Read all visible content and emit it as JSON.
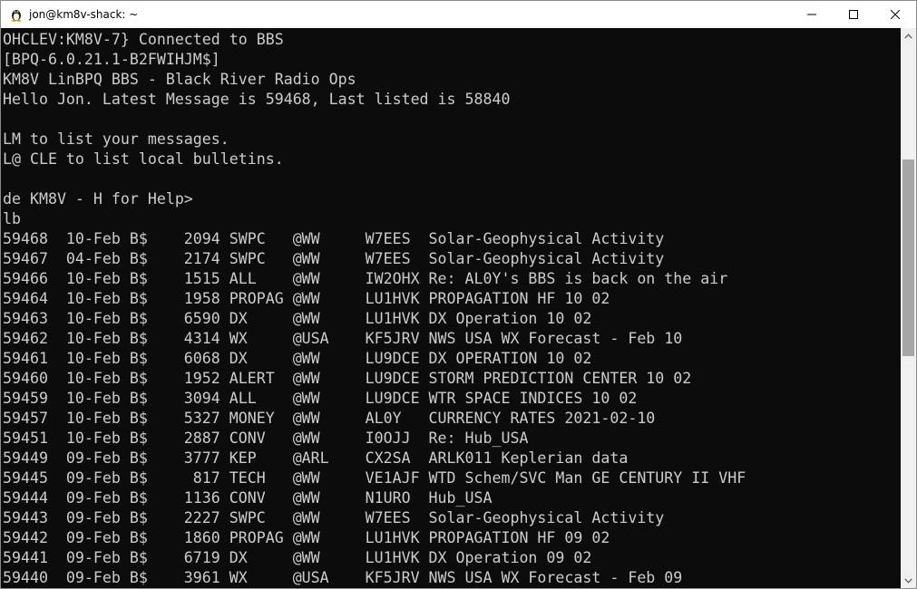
{
  "window": {
    "title": "jon@km8v-shack: ~"
  },
  "terminal": {
    "lines": [
      "OHCLEV:KM8V-7} Connected to BBS",
      "[BPQ-6.0.21.1-B2FWIHJM$]",
      "KM8V LinBPQ BBS - Black River Radio Ops",
      "Hello Jon. Latest Message is 59468, Last listed is 58840",
      "",
      "LM to list your messages.",
      "L@ CLE to list local bulletins.",
      "",
      "de KM8V - H for Help>",
      "lb",
      "59468  10-Feb B$    2094 SWPC   @WW     W7EES  Solar-Geophysical Activity",
      "59467  04-Feb B$    2174 SWPC   @WW     W7EES  Solar-Geophysical Activity",
      "59466  10-Feb B$    1515 ALL    @WW     IW2OHX Re: AL0Y's BBS is back on the air",
      "59464  10-Feb B$    1958 PROPAG @WW     LU1HVK PROPAGATION HF 10 02",
      "59463  10-Feb B$    6590 DX     @WW     LU1HVK DX Operation 10 02",
      "59462  10-Feb B$    4314 WX     @USA    KF5JRV NWS USA WX Forecast - Feb 10",
      "59461  10-Feb B$    6068 DX     @WW     LU9DCE DX OPERATION 10 02",
      "59460  10-Feb B$    1952 ALERT  @WW     LU9DCE STORM PREDICTION CENTER 10 02",
      "59459  10-Feb B$    3094 ALL    @WW     LU9DCE WTR SPACE INDICES 10 02",
      "59457  10-Feb B$    5327 MONEY  @WW     AL0Y   CURRENCY RATES 2021-02-10",
      "59451  10-Feb B$    2887 CONV   @WW     I0OJJ  Re: Hub_USA",
      "59449  09-Feb B$    3777 KEP    @ARL    CX2SA  ARLK011 Keplerian data",
      "59445  09-Feb B$     817 TECH   @WW     VE1AJF WTD Schem/SVC Man GE CENTURY II VHF",
      "59444  09-Feb B$    1136 CONV   @WW     N1URO  Hub_USA",
      "59443  09-Feb B$    2227 SWPC   @WW     W7EES  Solar-Geophysical Activity",
      "59442  09-Feb B$    1860 PROPAG @WW     LU1HVK PROPAGATION HF 09 02",
      "59441  09-Feb B$    6719 DX     @WW     LU1HVK DX Operation 09 02",
      "59440  09-Feb B$    3961 WX     @USA    KF5JRV NWS USA WX Forecast - Feb 09"
    ]
  },
  "scrollbar": {
    "position_fraction": 0.22,
    "visible_fraction": 0.37
  },
  "colors": {
    "terminal_bg": "#0c0c0c",
    "terminal_fg": "#cccccc",
    "scroll_thumb": "#a6a6a6"
  },
  "icons": {
    "app": "tux-penguin-icon",
    "minimize": "minimize-icon",
    "maximize": "maximize-icon",
    "close": "close-icon",
    "scroll_up": "chevron-up-icon",
    "scroll_down": "chevron-down-icon"
  }
}
